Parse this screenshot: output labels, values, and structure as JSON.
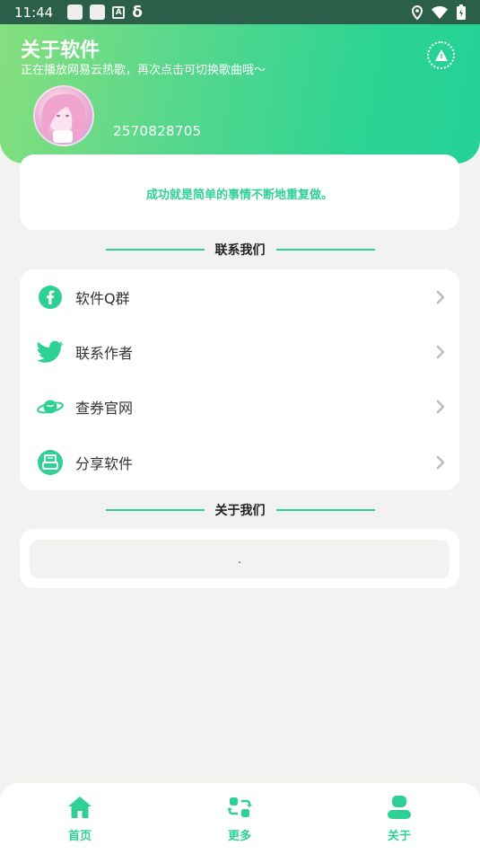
{
  "status_bar": {
    "time": "11:44"
  },
  "header": {
    "title": "关于软件",
    "subtitle": "正在播放网易云热歌，再次点击可切换歌曲哦〜",
    "qq_number": "2570828705"
  },
  "motto": "成功就是简单的事情不断地重复做。",
  "contact_section": {
    "title": "联系我们",
    "items": [
      {
        "label": "软件Q群",
        "icon": "facebook-icon"
      },
      {
        "label": "联系作者",
        "icon": "twitter-icon"
      },
      {
        "label": "查券官网",
        "icon": "planet-icon"
      },
      {
        "label": "分享软件",
        "icon": "print-icon"
      }
    ]
  },
  "about_section": {
    "title": "关于我们",
    "content": "."
  },
  "tabbar": {
    "tabs": [
      {
        "label": "首页",
        "icon": "home-icon"
      },
      {
        "label": "更多",
        "icon": "swap-icon"
      },
      {
        "label": "关于",
        "icon": "user-icon"
      }
    ]
  },
  "colors": {
    "accent": "#2fd095",
    "header_start": "#86df7e",
    "header_end": "#23d197",
    "background": "#f2f3f1"
  }
}
